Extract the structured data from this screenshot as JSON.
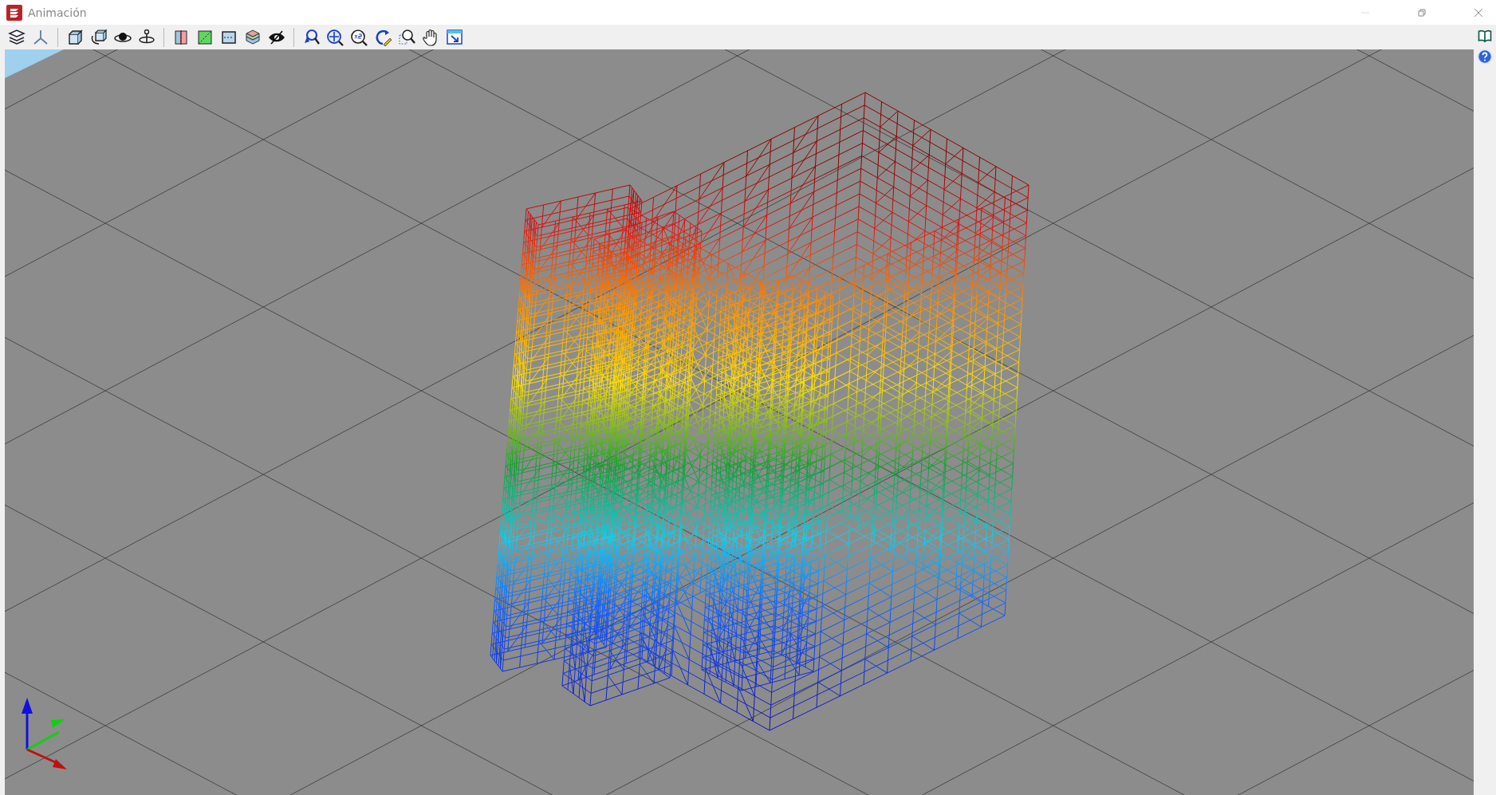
{
  "window": {
    "title": "Animación"
  }
}
